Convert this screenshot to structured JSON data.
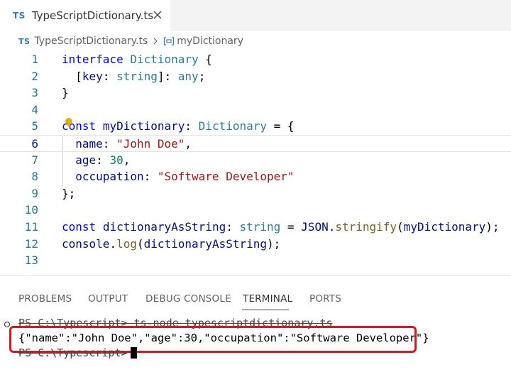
{
  "tab": {
    "badge": "TS",
    "title": "TypeScriptDictionary.ts",
    "close_icon": "close-icon"
  },
  "breadcrumb": {
    "badge": "TS",
    "file": "TypeScriptDictionary.ts",
    "symbol": "myDictionary",
    "symbol_icon": "variable-symbol-icon"
  },
  "editor": {
    "line_numbers": [
      "1",
      "2",
      "3",
      "4",
      "5",
      "6",
      "7",
      "8",
      "9",
      "10",
      "11",
      "12",
      "13"
    ],
    "current_line": 6
  },
  "panel": {
    "tabs": [
      "PROBLEMS",
      "OUTPUT",
      "DEBUG CONSOLE",
      "TERMINAL",
      "PORTS"
    ],
    "active_tab": "TERMINAL"
  },
  "terminal": {
    "command_line": "PS C:\\Typescript> ts-node typescriptdictionary.ts",
    "output": "{\"name\":\"John Doe\",\"age\":30,\"occupation\":\"Software Developer\"}",
    "prompt": "PS C:\\Typescript>"
  },
  "colors": {
    "keyword": "#0000ff",
    "type": "#267f99",
    "variable": "#001080",
    "string": "#a31515",
    "number": "#098658",
    "highlight_border": "#e0141b",
    "ts_badge": "#3178c6"
  }
}
